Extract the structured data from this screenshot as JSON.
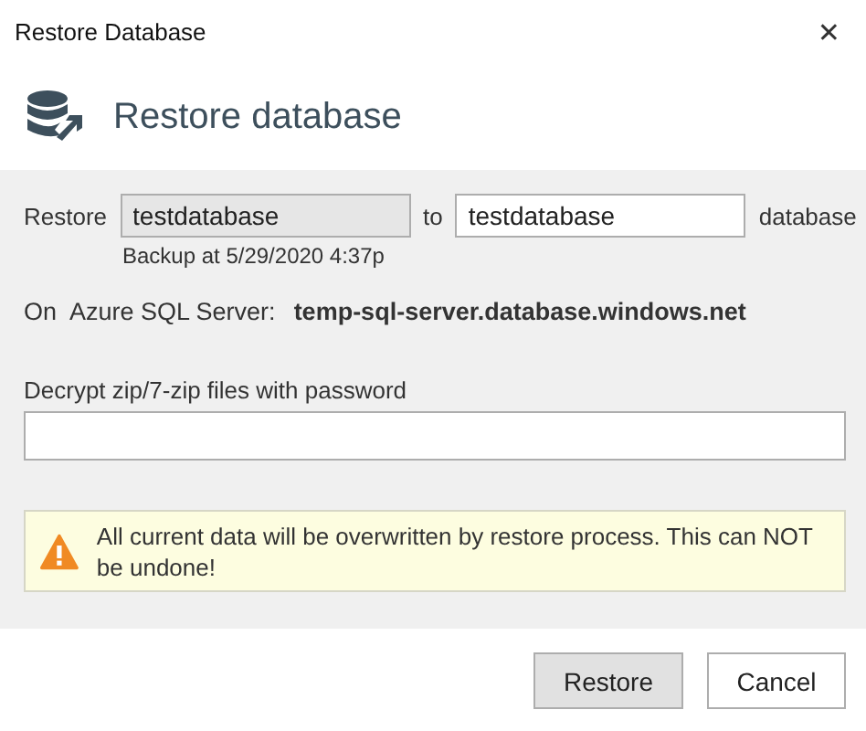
{
  "window": {
    "title": "Restore Database",
    "close": "✕"
  },
  "header": {
    "title": "Restore database"
  },
  "restore_row": {
    "label": "Restore",
    "source": {
      "value": "testdatabase",
      "disabled": true
    },
    "to": "to",
    "target": {
      "value": "testdatabase",
      "disabled": false
    },
    "suffix": "database"
  },
  "backup_note": "Backup at 5/29/2020 4:37p",
  "server": {
    "on": "On",
    "label": "Azure SQL Server:",
    "name": "temp-sql-server.database.windows.net"
  },
  "password": {
    "label": "Decrypt zip/7-zip files with password"
  },
  "warning": {
    "text": "All current data will be overwritten by restore process. This can NOT be undone!"
  },
  "buttons": [
    {
      "label": "Restore",
      "default": true
    },
    {
      "label": "Cancel",
      "default": false
    }
  ]
}
